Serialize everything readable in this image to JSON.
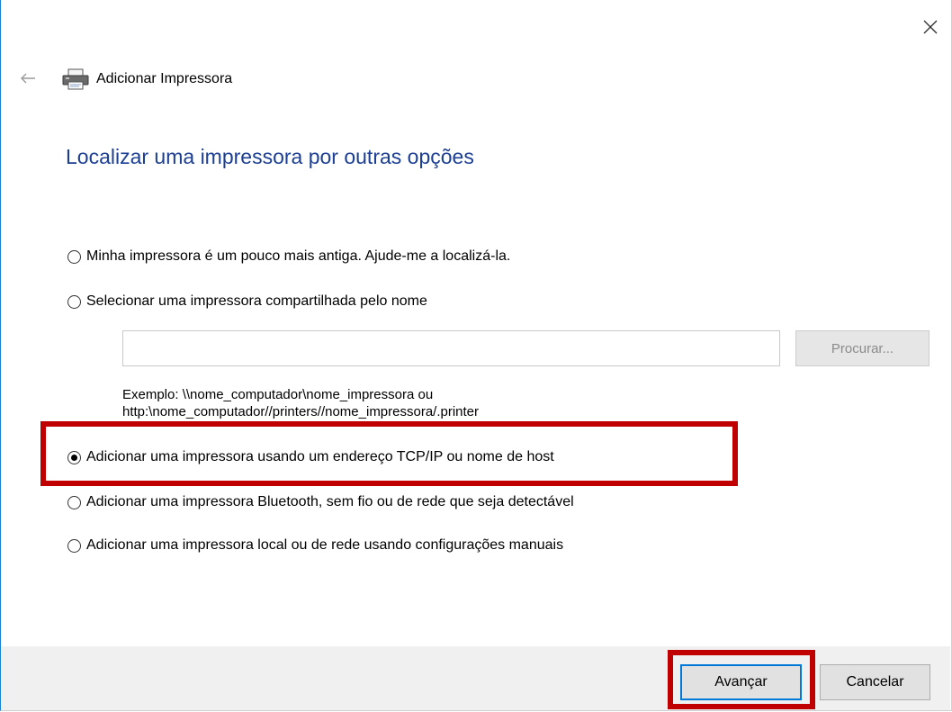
{
  "window": {
    "title": "Adicionar Impressora"
  },
  "heading": "Localizar uma impressora por outras opções",
  "options": [
    {
      "label": "Minha impressora é um pouco mais antiga. Ajude-me a localizá-la.",
      "selected": false
    },
    {
      "label": "Selecionar uma impressora compartilhada pelo nome",
      "selected": false
    },
    {
      "label": "Adicionar uma impressora usando um endereço TCP/IP ou nome de host",
      "selected": true
    },
    {
      "label": "Adicionar uma impressora Bluetooth, sem fio ou de rede que seja detectável",
      "selected": false
    },
    {
      "label": "Adicionar uma impressora local ou de rede usando configurações manuais",
      "selected": false
    }
  ],
  "share_input": {
    "value": "",
    "placeholder": ""
  },
  "browse_label": "Procurar...",
  "example": {
    "line1": "Exemplo: \\\\nome_computador\\nome_impressora ou",
    "line2": "http:\\nome_computador//printers//nome_impressora/.printer"
  },
  "buttons": {
    "next": "Avançar",
    "cancel": "Cancelar"
  },
  "icons": {
    "close": "close-icon",
    "back": "back-arrow-icon",
    "printer": "printer-icon"
  },
  "colors": {
    "heading": "#1c3f94",
    "highlight": "#c00000",
    "accent": "#0078d7"
  }
}
